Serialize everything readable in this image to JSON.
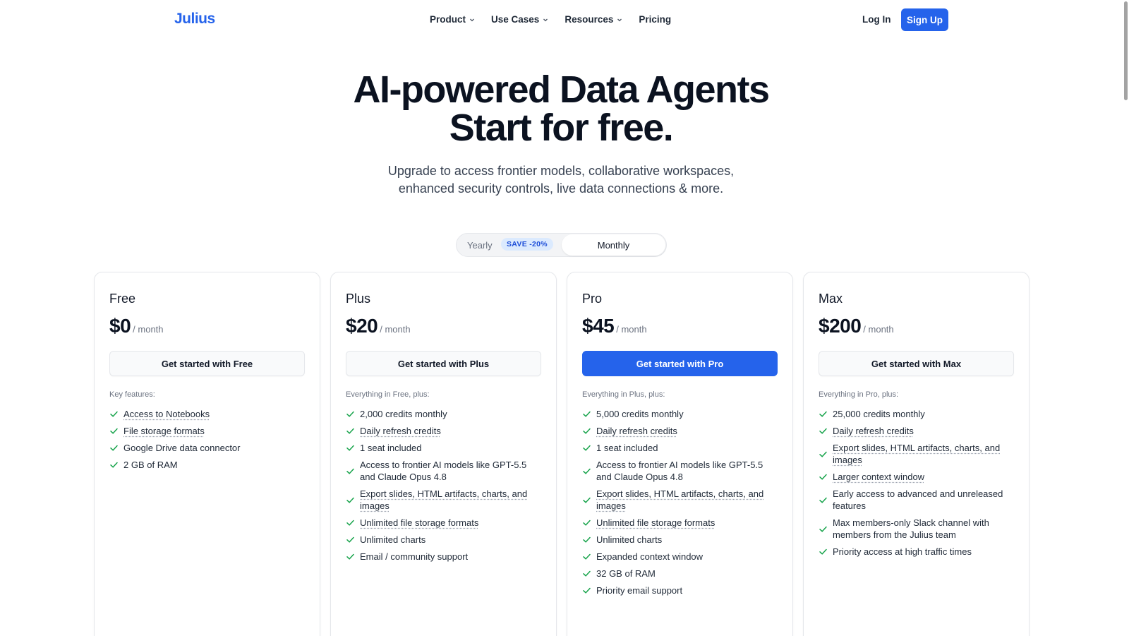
{
  "nav": {
    "logo": "Julius",
    "links": [
      {
        "label": "Product",
        "dropdown": true
      },
      {
        "label": "Use Cases",
        "dropdown": true
      },
      {
        "label": "Resources",
        "dropdown": true
      },
      {
        "label": "Pricing",
        "dropdown": false
      }
    ],
    "login": "Log In",
    "signup": "Sign Up"
  },
  "hero": {
    "title_line1": "AI-powered Data Agents",
    "title_line2": "Start for free.",
    "subtitle_line1": "Upgrade to access frontier models, collaborative workspaces,",
    "subtitle_line2": "enhanced security controls, live data connections & more."
  },
  "billing_toggle": {
    "yearly": "Yearly",
    "badge": "SAVE -20%",
    "monthly": "Monthly",
    "selected": "Monthly"
  },
  "colors": {
    "accent": "#2563eb",
    "check": "#16a34a"
  },
  "plans": [
    {
      "name": "Free",
      "price": "$0",
      "period": "/ month",
      "cta": "Get started with Free",
      "primary": false,
      "features_heading": "Key features:",
      "features": [
        {
          "text": "Access to Notebooks",
          "underline": true
        },
        {
          "text": "File storage formats",
          "underline": true
        },
        {
          "text": "Google Drive data connector",
          "underline": false
        },
        {
          "text": "2 GB of RAM",
          "underline": false
        }
      ]
    },
    {
      "name": "Plus",
      "price": "$20",
      "period": "/ month",
      "cta": "Get started with Plus",
      "primary": false,
      "features_heading": "Everything in Free, plus:",
      "features": [
        {
          "text": "2,000 credits monthly",
          "underline": false
        },
        {
          "text": "Daily refresh credits",
          "underline": true
        },
        {
          "text": "1 seat included",
          "underline": false
        },
        {
          "text": "Access to frontier AI models like GPT-5.5 and Claude Opus 4.8",
          "underline": false
        },
        {
          "text": "Export slides, HTML artifacts, charts, and images",
          "underline": true
        },
        {
          "text": "Unlimited file storage formats",
          "underline": true
        },
        {
          "text": "Unlimited charts",
          "underline": false
        },
        {
          "text": "Email / community support",
          "underline": false
        }
      ]
    },
    {
      "name": "Pro",
      "price": "$45",
      "period": "/ month",
      "cta": "Get started with Pro",
      "primary": true,
      "features_heading": "Everything in Plus, plus:",
      "features": [
        {
          "text": "5,000 credits monthly",
          "underline": false
        },
        {
          "text": "Daily refresh credits",
          "underline": true
        },
        {
          "text": "1 seat included",
          "underline": false
        },
        {
          "text": "Access to frontier AI models like GPT-5.5 and Claude Opus 4.8",
          "underline": false
        },
        {
          "text": "Export slides, HTML artifacts, charts, and images",
          "underline": true
        },
        {
          "text": "Unlimited file storage formats",
          "underline": true
        },
        {
          "text": "Unlimited charts",
          "underline": false
        },
        {
          "text": "Expanded context window",
          "underline": false
        },
        {
          "text": "32 GB of RAM",
          "underline": false
        },
        {
          "text": "Priority email support",
          "underline": false
        }
      ]
    },
    {
      "name": "Max",
      "price": "$200",
      "period": "/ month",
      "cta": "Get started with Max",
      "primary": false,
      "features_heading": "Everything in Pro, plus:",
      "features": [
        {
          "text": "25,000 credits monthly",
          "underline": false
        },
        {
          "text": "Daily refresh credits",
          "underline": true
        },
        {
          "text": "Export slides, HTML artifacts, charts, and images",
          "underline": true
        },
        {
          "text": "Larger context window",
          "underline": true
        },
        {
          "text": "Early access to advanced and unreleased features",
          "underline": false
        },
        {
          "text": "Max members-only Slack channel with members from the Julius team",
          "underline": false
        },
        {
          "text": "Priority access at high traffic times",
          "underline": false
        }
      ]
    }
  ]
}
